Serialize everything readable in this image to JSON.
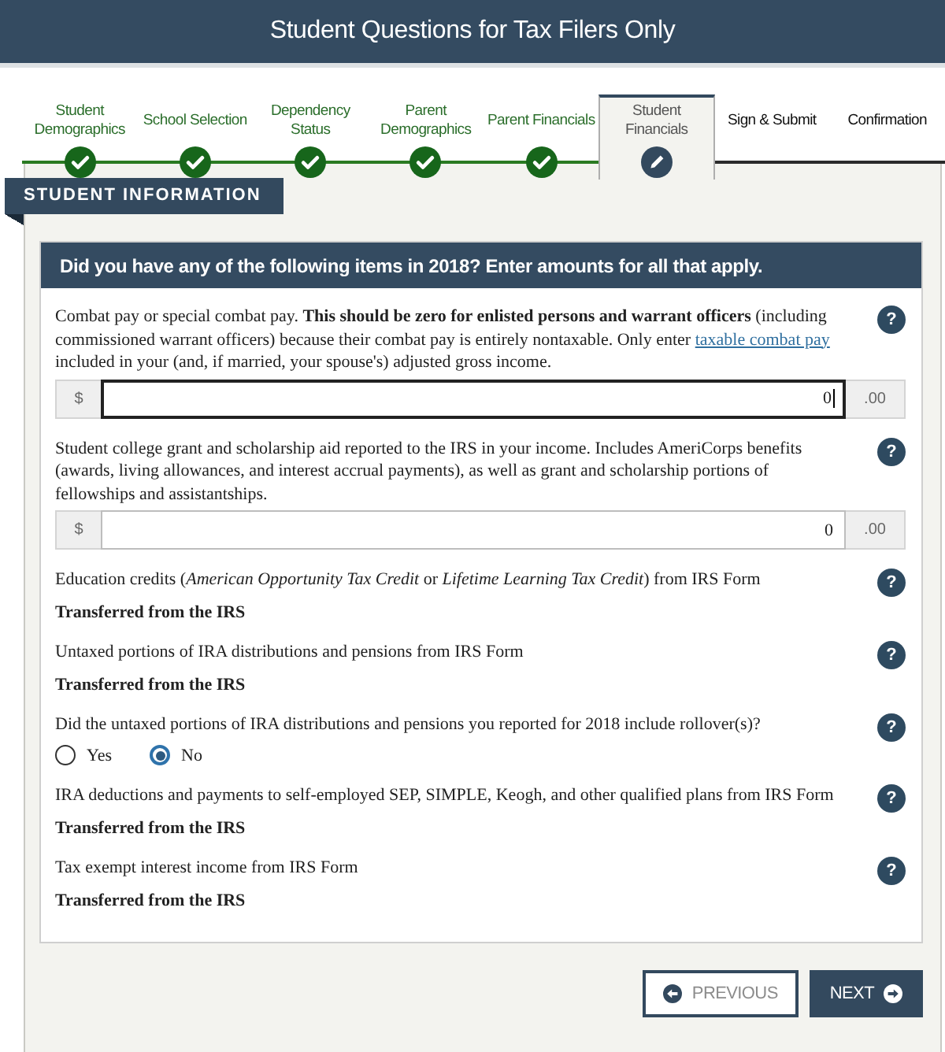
{
  "header": {
    "title": "Student Questions for Tax Filers Only"
  },
  "steps": [
    {
      "label": "Student Demographics",
      "completed": true,
      "selected": false
    },
    {
      "label": "School Selection",
      "completed": true,
      "selected": false
    },
    {
      "label": "Dependency Status",
      "completed": true,
      "selected": false
    },
    {
      "label": "Parent Demographics",
      "completed": true,
      "selected": false
    },
    {
      "label": "Parent Financials",
      "completed": true,
      "selected": false
    },
    {
      "label": "Student Financials",
      "completed": false,
      "selected": true
    },
    {
      "label": "Sign & Submit",
      "completed": false,
      "selected": false
    },
    {
      "label": "Confirmation",
      "completed": false,
      "selected": false
    }
  ],
  "section": {
    "title": "STUDENT INFORMATION"
  },
  "card": {
    "heading": "Did you have any of the following items in 2018? Enter amounts for all that apply.",
    "questions": [
      {
        "kind": "amount",
        "parts": [
          {
            "kind": "text",
            "text": "Combat pay or special combat pay. **This should be zero for enlisted persons and warrant officers** (including commissioned warrant officers) because their combat pay is entirely nontaxable. Only enter "
          },
          {
            "kind": "link",
            "text": "taxable combat pay"
          },
          {
            "kind": "text",
            "text": " included in your (and, if married, your spouse's) adjusted gross income."
          }
        ],
        "help": "?",
        "field": {
          "prefix": "$",
          "value": "0",
          "suffix": ".00",
          "focused": true
        }
      },
      {
        "kind": "amount",
        "parts": [
          {
            "kind": "text",
            "text": "Student college grant and scholarship aid reported to the IRS in your income. Includes AmeriCorps benefits (awards, living allowances, and interest accrual payments), as well as grant and scholarship portions of fellowships and assistantships."
          }
        ],
        "help": "?",
        "field": {
          "prefix": "$",
          "value": "0",
          "suffix": ".00",
          "focused": false
        }
      },
      {
        "kind": "transferred",
        "parts": [
          {
            "kind": "text",
            "text": "Education credits (*American Opportunity Tax Credit* or *Lifetime Learning Tax Credit*) from IRS Form"
          }
        ],
        "help": "?",
        "note": "Transferred from the IRS"
      },
      {
        "kind": "transferred",
        "parts": [
          {
            "kind": "text",
            "text": "Untaxed portions of IRA distributions and pensions from IRS Form"
          }
        ],
        "help": "?",
        "note": "Transferred from the IRS"
      },
      {
        "kind": "yes_no",
        "parts": [
          {
            "kind": "text",
            "text": "Did the untaxed portions of IRA distributions and pensions you reported for 2018 include rollover(s)?"
          }
        ],
        "help": "?",
        "options": [
          {
            "label": "Yes",
            "selected": false
          },
          {
            "label": "No",
            "selected": true
          }
        ]
      },
      {
        "kind": "transferred",
        "parts": [
          {
            "kind": "text",
            "text": "IRA deductions and payments to self-employed SEP, SIMPLE, Keogh, and other qualified plans from IRS Form"
          }
        ],
        "help": "?",
        "note": "Transferred from the IRS"
      },
      {
        "kind": "transferred",
        "parts": [
          {
            "kind": "text",
            "text": "Tax exempt interest income from IRS Form"
          }
        ],
        "help": "?",
        "note": "Transferred from the IRS"
      }
    ]
  },
  "buttons": [
    {
      "label": "PREVIOUS",
      "kind": "back"
    },
    {
      "label": "NEXT",
      "kind": "forward"
    }
  ]
}
